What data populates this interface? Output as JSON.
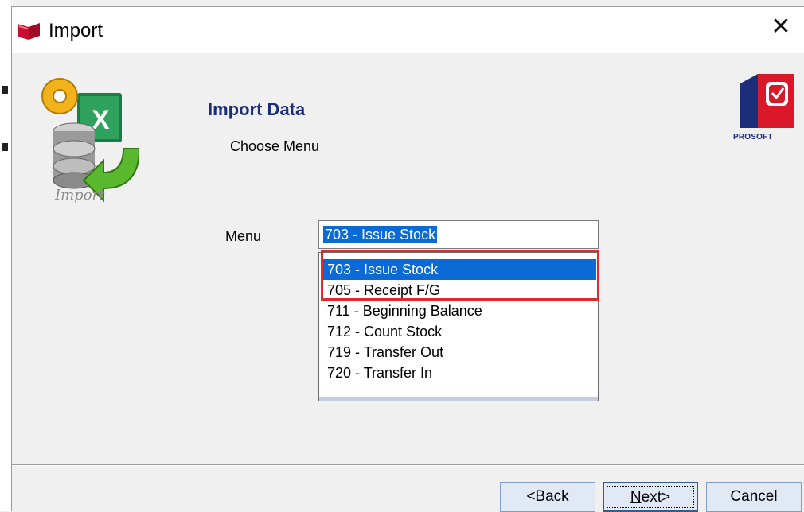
{
  "window": {
    "title": "Import",
    "close_glyph": "✕"
  },
  "header": {
    "icon_label": "Import",
    "title": "Import Data",
    "subtitle": "Choose Menu",
    "logo_text": "PROSOFT"
  },
  "form": {
    "menu_label": "Menu",
    "menu_value": "703 - Issue Stock",
    "options": [
      {
        "label": "703 - Issue Stock",
        "selected": true
      },
      {
        "label": "705 - Receipt F/G",
        "selected": false
      },
      {
        "label": "711 - Beginning Balance",
        "selected": false
      },
      {
        "label": "712 - Count Stock",
        "selected": false
      },
      {
        "label": "719 - Transfer Out",
        "selected": false
      },
      {
        "label": "720 - Transfer In",
        "selected": false
      }
    ]
  },
  "buttons": {
    "back_prefix": "<",
    "back_key": "B",
    "back_rest": "ack",
    "next_key": "N",
    "next_rest": "ext>",
    "cancel_key": "C",
    "cancel_rest": "ancel"
  },
  "colors": {
    "selection": "#0a6ad6",
    "highlight_border": "#dc2c2c",
    "title_blue": "#1a2e7a"
  },
  "icons": [
    "book-icon",
    "import-excel-icon",
    "prosoft-logo-icon",
    "close-icon"
  ]
}
